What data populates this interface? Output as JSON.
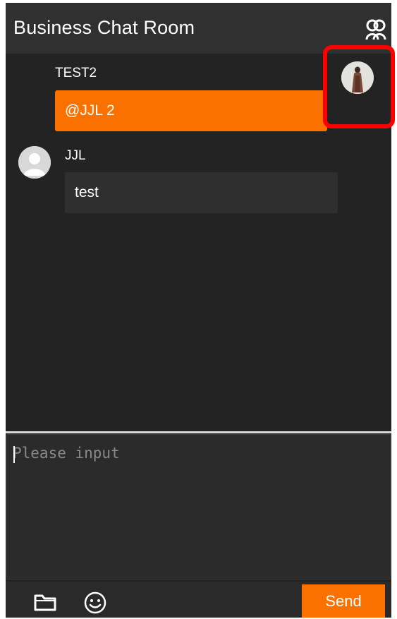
{
  "header": {
    "title": "Business Chat Room",
    "members_icon": "members-icon"
  },
  "messages": [
    {
      "sender": "TEST2",
      "text": "@JJL 2",
      "side": "right",
      "bubble_color": "#fb7100"
    },
    {
      "sender": "JJL",
      "text": "test",
      "side": "left",
      "bubble_color": "#2f2f2f"
    }
  ],
  "composer": {
    "placeholder": "Please input",
    "value": ""
  },
  "toolbar": {
    "folder_icon": "folder-icon",
    "emoji_icon": "emoji-icon",
    "send_label": "Send"
  },
  "colors": {
    "accent": "#fb7100",
    "highlight": "#ff0000",
    "background": "#232323",
    "header": "#303030"
  }
}
